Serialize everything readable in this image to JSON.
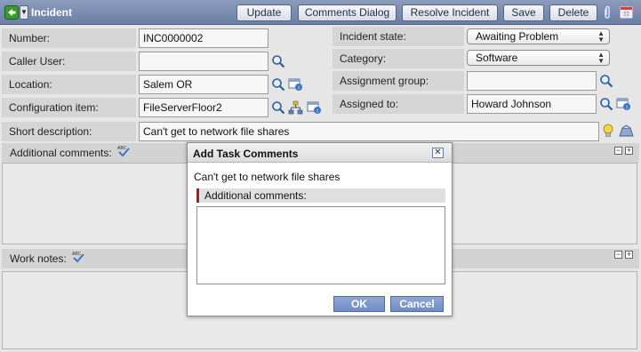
{
  "header": {
    "title": "Incident",
    "buttons": {
      "update": "Update",
      "comments_dialog": "Comments Dialog",
      "resolve_incident": "Resolve Incident",
      "save": "Save",
      "delete": "Delete"
    }
  },
  "form": {
    "number_label": "Number:",
    "number_value": "INC0000002",
    "caller_label": "Caller User:",
    "caller_value": "",
    "location_label": "Location:",
    "location_value": "Salem OR",
    "config_label": "Configuration item:",
    "config_value": "FileServerFloor2",
    "short_desc_label": "Short description:",
    "short_desc_value": "Can't get to network file shares",
    "state_label": "Incident state:",
    "state_value": "Awaiting Problem",
    "category_label": "Category:",
    "category_value": "Software",
    "assignment_group_label": "Assignment group:",
    "assignment_group_value": "",
    "assigned_to_label": "Assigned to:",
    "assigned_to_value": "Howard Johnson",
    "additional_comments_label": "Additional comments:",
    "work_notes_label": "Work notes:"
  },
  "dialog": {
    "title": "Add Task Comments",
    "text": "Can't get to network file shares",
    "field_label": "Additional comments:",
    "field_value": "",
    "ok": "OK",
    "cancel": "Cancel"
  },
  "icons": {
    "back": "back-arrow-icon",
    "menu": "context-menu-icon",
    "attachment": "paperclip-icon",
    "calendar": "calendar-icon",
    "lookup": "magnifier-icon",
    "reference": "reference-info-icon",
    "dependency": "dependency-map-icon",
    "suggestion": "lightbulb-icon",
    "knowledge": "knowledge-icon",
    "spellcheck": "spell-check-icon"
  },
  "colors": {
    "header_bg": "#7a8db1",
    "dialog_button": "#7f98cc",
    "mandatory_marker": "#b01c1c"
  }
}
